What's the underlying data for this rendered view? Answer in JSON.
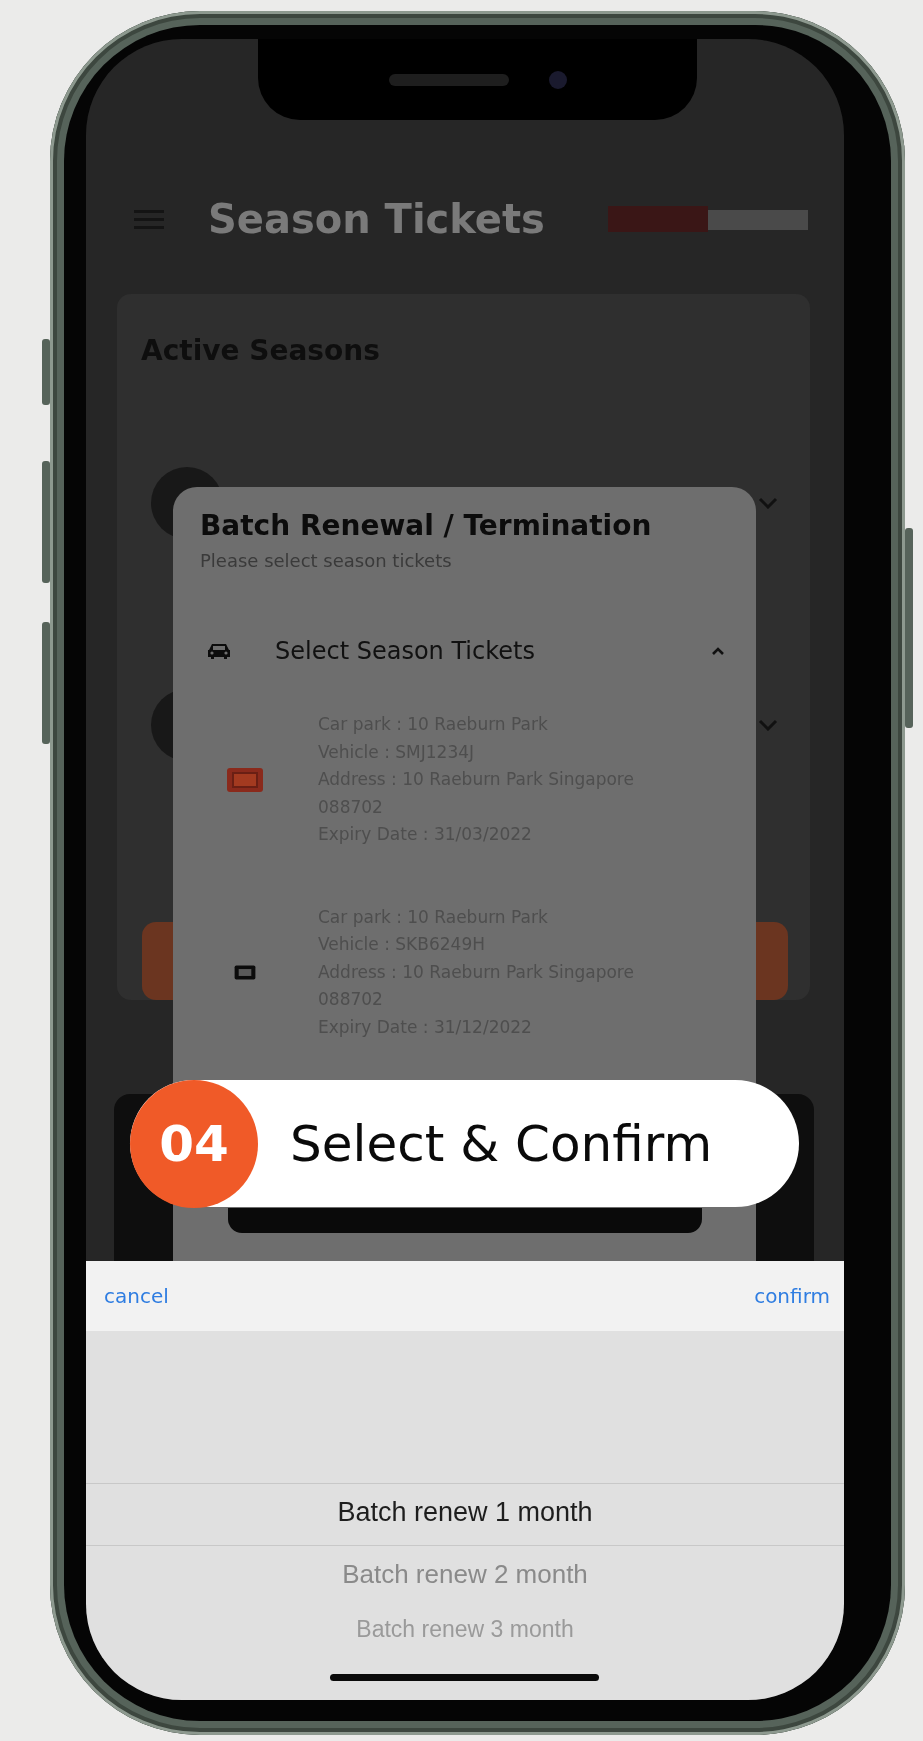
{
  "header": {
    "title": "Season Tickets"
  },
  "card": {
    "title": "Active Seasons",
    "rows": [
      {
        "expanded": false
      },
      {
        "expanded": false
      }
    ]
  },
  "modal": {
    "title": "Batch Renewal / Termination",
    "subtitle": "Please select season tickets",
    "section": {
      "label": "Select Season Tickets",
      "expanded": true
    },
    "tickets": [
      {
        "selected": true,
        "lines": [
          "Car park : 10 Raeburn Park",
          "Vehicle : SMJ1234J",
          "Address : 10 Raeburn Park Singapore",
          "088702",
          "Expiry Date : 31/03/2022"
        ]
      },
      {
        "selected": false,
        "lines": [
          "Car park : 10 Raeburn Park",
          "Vehicle : SKB6249H",
          "Address : 10 Raeburn Park Singapore",
          "088702",
          "Expiry Date : 31/12/2022"
        ]
      }
    ]
  },
  "step_banner": {
    "number": "04",
    "label": "Select & Confirm"
  },
  "picker": {
    "cancel": "cancel",
    "confirm": "confirm",
    "options": [
      {
        "label": "Batch renew 1 month",
        "selected": true
      },
      {
        "label": "Batch renew 2 month",
        "selected": false
      },
      {
        "label": "Batch renew 3 month",
        "selected": false
      }
    ]
  }
}
